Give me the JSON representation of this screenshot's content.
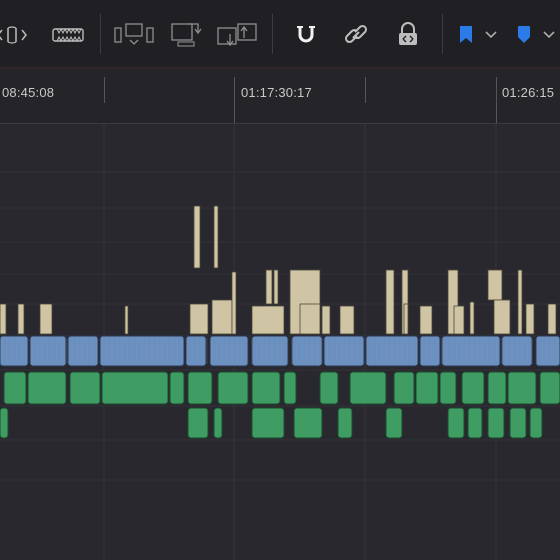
{
  "toolbar": {
    "tools": [
      {
        "id": "trim-edit-mode",
        "icon": "trim-edit-mode-icon"
      },
      {
        "id": "blade-edit-mode",
        "icon": "blade-icon"
      },
      {
        "id": "insert-clip",
        "icon": "insert-clip-icon"
      },
      {
        "id": "overwrite-clip",
        "icon": "overwrite-clip-icon"
      },
      {
        "id": "replace-clip",
        "icon": "replace-clip-icon"
      },
      {
        "id": "snapping",
        "icon": "magnet-icon",
        "active": true
      },
      {
        "id": "linked-selection",
        "icon": "link-icon"
      },
      {
        "id": "position-lock",
        "icon": "lock-icon"
      },
      {
        "id": "flag",
        "icon": "flag-icon",
        "color": "#2b7be8"
      },
      {
        "id": "marker",
        "icon": "marker-icon",
        "color": "#2b7be8"
      }
    ]
  },
  "ruler": {
    "timecodes": [
      "08:45:08",
      "01:17:30:17",
      "01:26:15"
    ]
  },
  "colors": {
    "background": "#28282e",
    "toolbar": "#1f1f24",
    "video_clip_beige": "#cfc5a5",
    "audio_clip_blue": "#6b8fbf",
    "audio_clip_green": "#3f9d64",
    "accent_blue": "#2b7be8"
  }
}
